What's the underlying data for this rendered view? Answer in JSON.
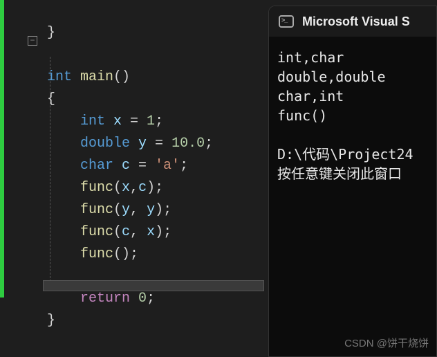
{
  "editor": {
    "fold_symbol": "−",
    "lines": {
      "l0_brace": "}",
      "l1_int": "int",
      "l1_main": " main",
      "l1_paren": "()",
      "l2_brace": "{",
      "l3_int": "    int",
      "l3_x": " x ",
      "l3_eq": "= ",
      "l3_1": "1",
      "l3_semi": ";",
      "l4_double": "    double",
      "l4_y": " y ",
      "l4_eq": "= ",
      "l4_10": "10.0",
      "l4_semi": ";",
      "l5_char": "    char",
      "l5_c": " c ",
      "l5_eq": "= ",
      "l5_a": "'a'",
      "l5_semi": ";",
      "l6_func": "    func",
      "l6_open": "(",
      "l6_x": "x",
      "l6_comma": ",",
      "l6_c": "c",
      "l6_close": ")",
      "l6_semi": ";",
      "l7_func": "    func",
      "l7_open": "(",
      "l7_y1": "y",
      "l7_comma": ", ",
      "l7_y2": "y",
      "l7_close": ")",
      "l7_semi": ";",
      "l8_func": "    func",
      "l8_open": "(",
      "l8_c": "c",
      "l8_comma": ", ",
      "l8_x": "x",
      "l8_close": ")",
      "l8_semi": ";",
      "l9_func": "    func",
      "l9_paren": "()",
      "l9_semi": ";",
      "l11_return": "    return",
      "l11_sp": " ",
      "l11_0": "0",
      "l11_semi": ";",
      "l12_brace": "}"
    }
  },
  "console": {
    "title": "Microsoft Visual S",
    "out1": "int,char",
    "out2": "double,double",
    "out3": "char,int",
    "out4": "func()",
    "blank": "",
    "path": "D:\\代码\\Project24",
    "prompt": "按任意键关闭此窗口"
  },
  "watermark": "CSDN @饼干烧饼"
}
